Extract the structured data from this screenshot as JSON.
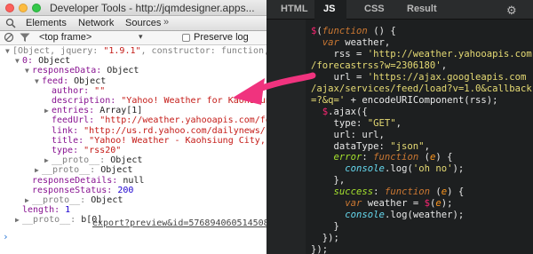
{
  "devtools": {
    "window_title": "Developer Tools - http://jqmdesigner.apps...",
    "tabs": [
      "Elements",
      "Network",
      "Sources"
    ],
    "more_tabs": "»",
    "frame_select": "<top frame>",
    "preserve_log": "Preserve log",
    "console_lines": [
      {
        "arrow": "▼",
        "text": "[Object, jquery: \"1.9.1\", constructor: function, ",
        "parts": [
          [
            "g",
            "[Object, jquery: "
          ],
          [
            "s",
            "\"1.9.1\""
          ],
          [
            "g",
            ", constructor: function, "
          ]
        ]
      },
      {
        "arrow": "▼",
        "text": "0: Object",
        "parts": [
          [
            "k",
            "0"
          ],
          [
            "",
            "Object"
          ]
        ]
      },
      {
        "arrow": "▼",
        "text": "responseData: Object",
        "parts": [
          [
            "k",
            "responseData"
          ],
          [
            "",
            "Object"
          ]
        ]
      },
      {
        "arrow": "▼",
        "text": "feed: Object",
        "parts": [
          [
            "k",
            "feed"
          ],
          [
            "",
            "Object"
          ]
        ]
      },
      {
        "arrow": "",
        "text": "author: \"\"",
        "parts": [
          [
            "k",
            "author"
          ],
          [
            "s",
            "\"\""
          ]
        ]
      },
      {
        "arrow": "",
        "text": "description: \"Yahoo! Weather for Kaohsiung",
        "parts": [
          [
            "k",
            "description"
          ],
          [
            "s",
            "\"Yahoo! Weather for Kaohsiung"
          ]
        ]
      },
      {
        "arrow": "▶",
        "text": "entries: Array[1]",
        "parts": [
          [
            "k",
            "entries"
          ],
          [
            "",
            "Array[1]"
          ]
        ]
      },
      {
        "arrow": "",
        "text": "feedUrl: \"http://weather.yahooapis.com/for",
        "parts": [
          [
            "k",
            "feedUrl"
          ],
          [
            "s",
            "\"http://weather.yahooapis.com/for"
          ]
        ]
      },
      {
        "arrow": "",
        "text": "link: \"http://us.rd.yahoo.com/dailynews/rs",
        "parts": [
          [
            "k",
            "link"
          ],
          [
            "s",
            "\"http://us.rd.yahoo.com/dailynews/rs"
          ]
        ]
      },
      {
        "arrow": "",
        "text": "title: \"Yahoo! Weather - Kaohsiung City, T",
        "parts": [
          [
            "k",
            "title"
          ],
          [
            "s",
            "\"Yahoo! Weather - Kaohsiung City, T"
          ]
        ]
      },
      {
        "arrow": "",
        "text": "type: \"rss20\"",
        "parts": [
          [
            "k",
            "type"
          ],
          [
            "s",
            "\"rss20\""
          ]
        ]
      },
      {
        "arrow": "▶",
        "text": "__proto__: Object",
        "parts": [
          [
            "g",
            "__proto__"
          ],
          [
            "",
            "Object"
          ]
        ]
      },
      {
        "arrow": "▶",
        "text": "__proto__: Object",
        "parts": [
          [
            "g",
            "__proto__"
          ],
          [
            "",
            "Object"
          ]
        ]
      },
      {
        "arrow": "",
        "text": "responseDetails: null",
        "parts": [
          [
            "k",
            "responseDetails"
          ],
          [
            "",
            "null"
          ]
        ]
      },
      {
        "arrow": "",
        "text": "responseStatus: 200",
        "parts": [
          [
            "k",
            "responseStatus"
          ],
          [
            "n",
            "200"
          ]
        ]
      },
      {
        "arrow": "▶",
        "text": "__proto__: Object",
        "parts": [
          [
            "g",
            "__proto__"
          ],
          [
            "",
            "Object"
          ]
        ]
      },
      {
        "arrow": "",
        "text": "length: 1",
        "parts": [
          [
            "k",
            "length"
          ],
          [
            "n",
            "1"
          ]
        ]
      },
      {
        "arrow": "▶",
        "text": "__proto__: b[0]",
        "parts": [
          [
            "g",
            "__proto__"
          ],
          [
            "",
            "b[0]"
          ]
        ]
      }
    ],
    "export_link": "export?preview&id=5768940605145088:14",
    "prompt": "›"
  },
  "editor": {
    "tabs": [
      "HTML",
      "JS",
      "CSS",
      "Result"
    ],
    "active_tab": "JS",
    "settings_icon": "gear-icon",
    "code_lines": [
      "$(function () {",
      "  var weather,",
      "    rss = 'http://weather.yahooapis.com",
      "/forecastrss?w=2306180',",
      "    url = 'https://ajax.googleapis.com",
      "/ajax/services/feed/load?v=1.0&callback",
      "=?&q=' + encodeURIComponent(rss);",
      "  $.ajax({",
      "    type: \"GET\",",
      "    url: url,",
      "    dataType: \"json\",",
      "    error: function (e) {",
      "      console.log('oh no');",
      "    },",
      "    success: function (e) {",
      "      var weather = $(e);",
      "      console.log(weather);",
      "    }",
      "  });",
      "});"
    ]
  },
  "colors": {
    "arrow": "#f0337e",
    "editor_bg": "#1d1f20",
    "accent_string": "#e6db74"
  }
}
